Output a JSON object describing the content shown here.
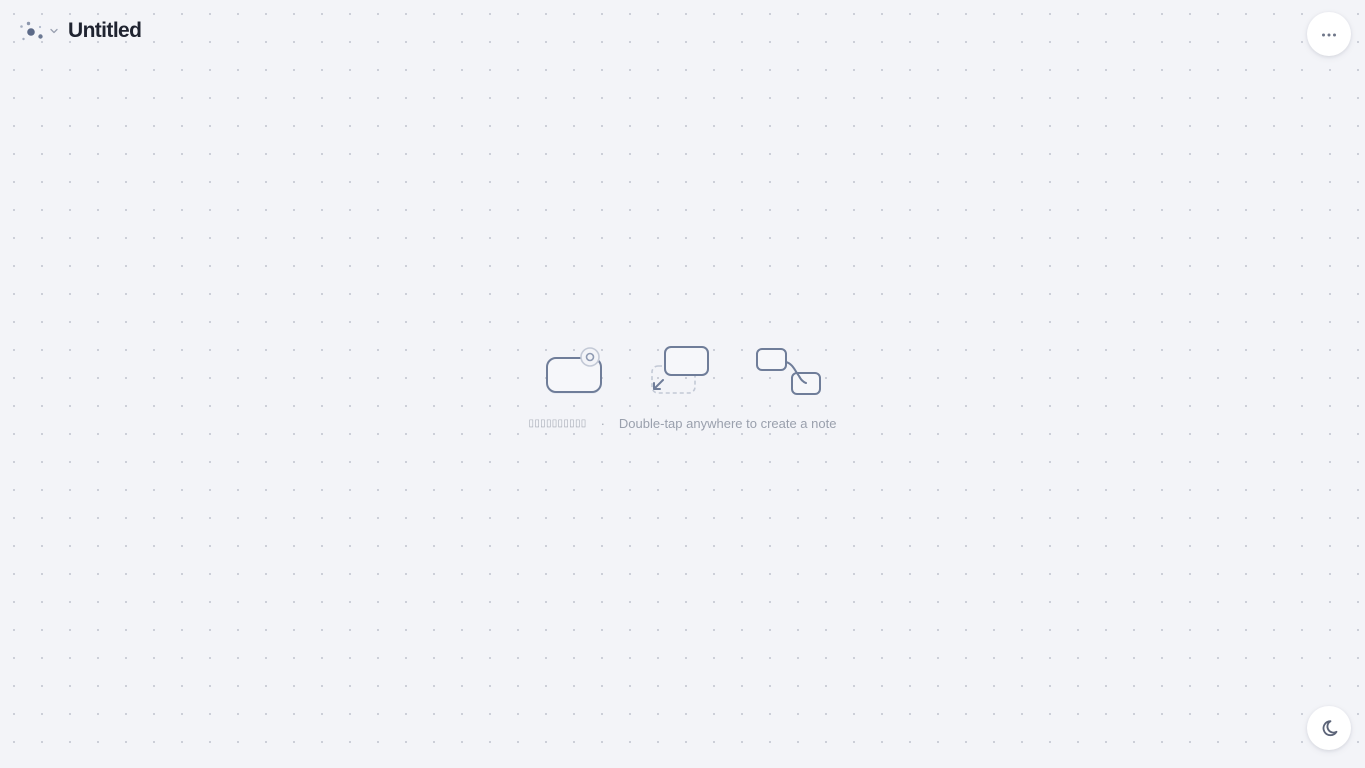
{
  "header": {
    "title": "Untitled",
    "logo_icon": "dots-logo-icon",
    "menu_icon": "chevron-down-icon"
  },
  "toolbar": {
    "more_icon": "more-horizontal-icon"
  },
  "theme": {
    "toggle_icon": "moon-icon"
  },
  "empty_state": {
    "icons": [
      "tap-note-icon",
      "drag-move-icon",
      "connect-notes-icon"
    ],
    "hint_left": "▯▯▯▯▯▯▯▯▯▯",
    "separator": "·",
    "hint_right": "Double-tap anywhere to create a note"
  },
  "colors": {
    "background": "#f3f4f8",
    "grid_dot": "#c9ccd6",
    "icon_stroke": "#6f7d99",
    "hint_text": "#9aa0ad",
    "title_text": "#1f2330"
  }
}
